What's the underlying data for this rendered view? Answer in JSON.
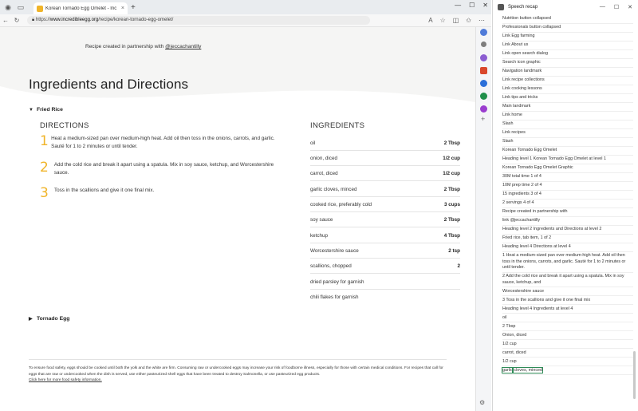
{
  "browser": {
    "tab_title": "Korean Tornado Egg Omelet - Inc",
    "url_prefix": "https://",
    "url_host": "www.incredibleegg.org",
    "url_path": "/recipe/korean-tornado-egg-omelet/",
    "new_tab": "+",
    "tab_close": "×"
  },
  "page": {
    "partner_prefix": "Recipe created in partnership with",
    "partner_handle": "@jeccachantilly",
    "heading": "Ingredients and Directions",
    "section_fried_rice": "Fried Rice",
    "section_tornado_egg": "Tornado Egg",
    "directions_title": "DIRECTIONS",
    "ingredients_title": "INGREDIENTS",
    "steps": [
      {
        "num": "1",
        "text": "Heat a medium-sized pan over medium-high heat. Add oil then toss in the onions, carrots, and garlic. Sauté for 1 to 2 minutes or until tender."
      },
      {
        "num": "2",
        "text": "Add the cold rice and break it apart using a spatula. Mix in soy sauce, ketchup, and Worcestershire sauce."
      },
      {
        "num": "3",
        "text": "Toss in the scallions and give it one final mix."
      }
    ],
    "ingredients": [
      {
        "name": "oil",
        "amount": "2 Tbsp"
      },
      {
        "name": "onion, diced",
        "amount": "1/2 cup"
      },
      {
        "name": "carrot, diced",
        "amount": "1/2 cup"
      },
      {
        "name": "garlic cloves, minced",
        "amount": "2 Tbsp"
      },
      {
        "name": "cooked rice, preferably cold",
        "amount": "3 cups"
      },
      {
        "name": "soy sauce",
        "amount": "2 Tbsp"
      },
      {
        "name": "ketchup",
        "amount": "4 Tbsp"
      },
      {
        "name": "Worcestershire sauce",
        "amount": "2 tsp"
      },
      {
        "name": "scallions, chopped",
        "amount": "2"
      },
      {
        "name": "dried parsley for garnish",
        "amount": ""
      },
      {
        "name": "chili flakes for garnish",
        "amount": ""
      }
    ],
    "safety_note": "To ensure food safety, eggs should be cooked until both the yolk and the white are firm. Consuming raw or undercooked eggs may increase your risk of foodborne illness, especially for those with certain medical conditions. For recipes that call for eggs that are raw or undercooked when the dish is served, use either pasteurized shell eggs that have been treated to destroy Salmonella, or use pasteurized egg products.",
    "safety_link": "Click here for more food safety information."
  },
  "panel": {
    "title": "Speech recap",
    "items": [
      "Nutrition button collapsed",
      "Professionals button collapsed",
      "Link Egg farming",
      "Link About us",
      "Link open search dialog",
      "Search icon graphic",
      "Navigation landmark",
      "Link recipe collections",
      "Link cooking lessons",
      "Link tips and tricks",
      "Main landmark",
      "Link home",
      "Slash",
      "Link recipes",
      "Slash",
      "Korean Tornado Egg Omelet",
      "Heading level 1 Korean Tornado Egg Omelet at level 1",
      "Korean Tornado Egg Omelet Graphic",
      "30M total time 1 of 4",
      "10M prep time 2 of 4",
      "15 ingredients 3 of 4",
      "2 servings 4 of 4",
      "Recipe created in partnership with",
      "link @jeccachantilly",
      "Heading level 2 Ingredients and Directions at level 2",
      "Fried rice, tab item, 1 of 2",
      "Heading level 4 Directions at level 4",
      "1 Heat a medium-sized pan over medium-high heat. Add oil then toss in the onions, carrots, and garlic. Sauté for 1 to 2 minutes or until tender.",
      "2 Add the cold rice and break it apart using a spatula. Mix in soy sauce, ketchup, and",
      "Worcestershire sauce",
      "3 Toss in the scallions and give it one final mix",
      "Heading level 4 Ingredients at level 4",
      "oil",
      "2 Tbsp",
      "Onion, diced",
      "1/2 cup",
      "carrot, diced",
      "1/2 cup"
    ],
    "last_item_highlight": "garlic",
    "last_item_rest": " cloves, minced"
  },
  "colors": {
    "accent": "#f0b429",
    "hero_bg": "#f5f5f4",
    "focus": "#2e8b57"
  }
}
